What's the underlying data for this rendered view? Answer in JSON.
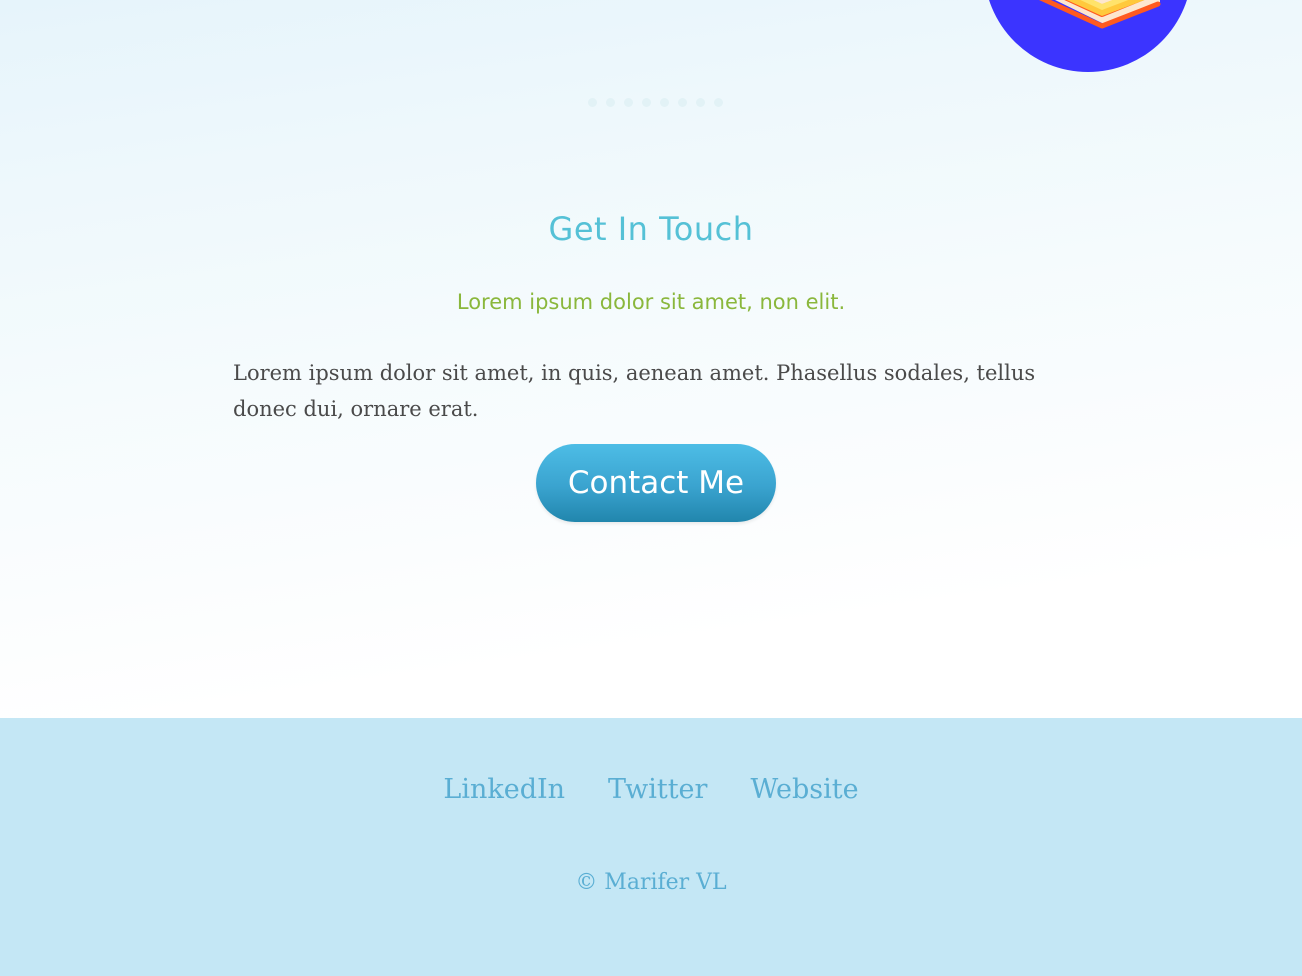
{
  "contact": {
    "title": "Get In Touch",
    "subtitle": "Lorem ipsum dolor sit amet, non elit.",
    "body": "Lorem ipsum dolor sit amet, in quis, aenean amet. Phasellus sodales, tellus donec dui, ornare erat.",
    "button_label": "Contact Me"
  },
  "footer": {
    "links": [
      {
        "label": "LinkedIn"
      },
      {
        "label": "Twitter"
      },
      {
        "label": "Website"
      }
    ],
    "copyright": "© Marifer VL"
  },
  "colors": {
    "accent": "#55c1d6",
    "subtitle": "#8ab73c",
    "button": "#3aa3cf",
    "footer_bg": "#c4e7f5",
    "footer_text": "#5aaed3",
    "illustration_bg": "#3b34ff"
  },
  "icons": {
    "illustration": "stacked-books-illustration-icon",
    "separator": "dotted-separator-icon"
  }
}
